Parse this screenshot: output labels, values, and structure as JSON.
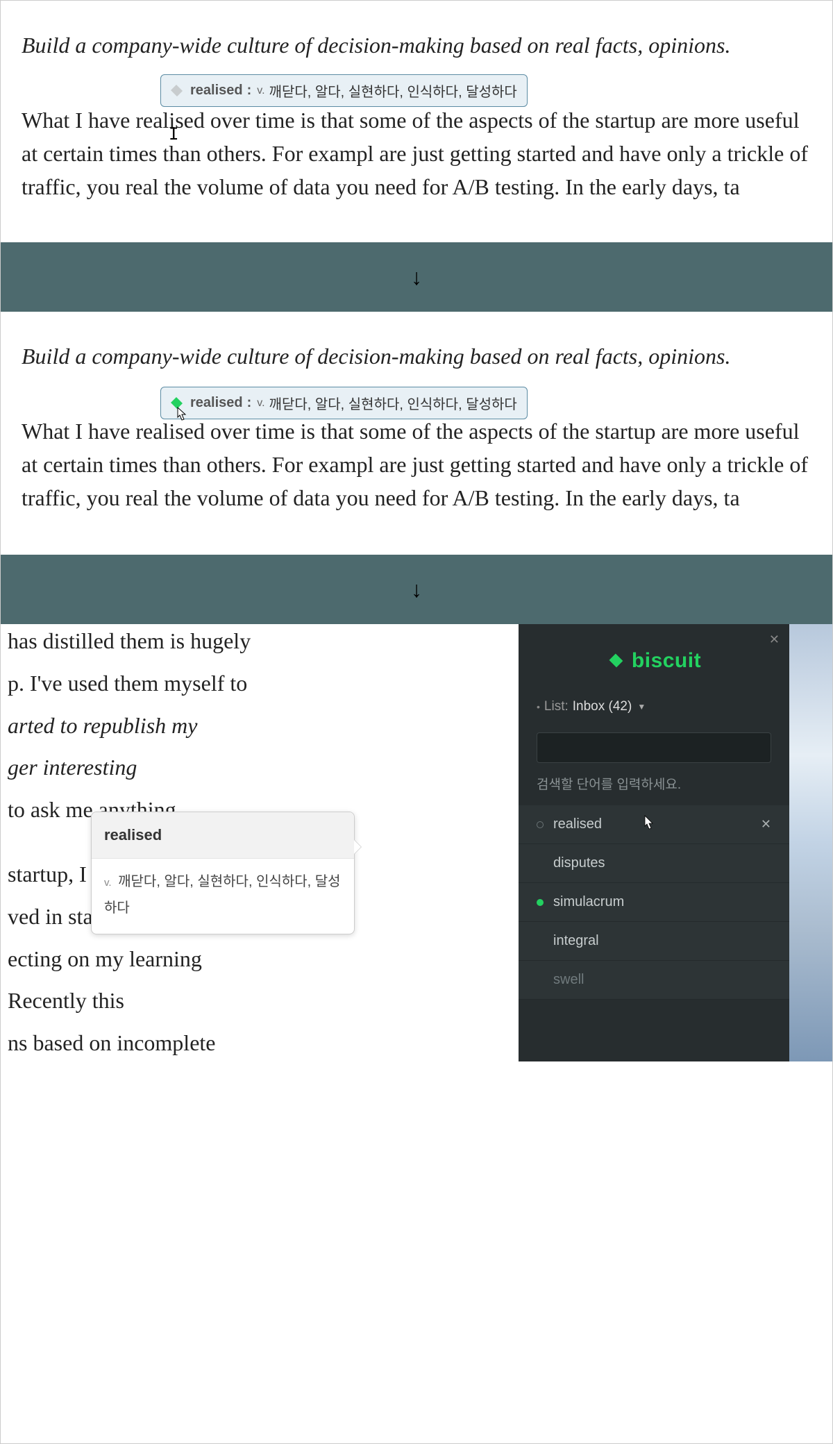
{
  "panel1": {
    "intro": "Build a company-wide culture of decision-making based on real facts, opinions.",
    "body": "What I have realised over time is that some of the aspects of the startup are more useful at certain times than others. For exampl are just getting started and have only a trickle of traffic, you real the volume of data you need for A/B testing. In the early days, ta",
    "tooltip": {
      "word": "realised",
      "pos": "v.",
      "def": "깨닫다, 알다, 실현하다, 인식하다, 달성하다"
    }
  },
  "panel2": {
    "intro": "Build a company-wide culture of decision-making based on real facts, opinions.",
    "body": "What I have realised over time is that some of the aspects of the startup are more useful at certain times than others. For exampl are just getting started and have only a trickle of traffic, you real the volume of data you need for A/B testing. In the early days, ta",
    "tooltip": {
      "word": "realised",
      "pos": "v.",
      "def": "깨닫다, 알다, 실현하다, 인식하다, 달성하다"
    }
  },
  "sep": {
    "arrow": "↓"
  },
  "left": {
    "lines": [
      " has distilled them is hugely",
      "p. I've used them myself to",
      "arted to republish my",
      "ger interesting",
      " to ask me anything.",
      "",
      " startup, I",
      "ved in star",
      "ecting on my learning",
      " Recently this",
      "ns based on incomplete"
    ],
    "popover": {
      "word": "realised",
      "pos": "v.",
      "def": "깨닫다, 알다, 실현하다, 인식하다, 달성하다"
    }
  },
  "sidebar": {
    "brand": "biscuit",
    "list_label": "List:",
    "list_value": "Inbox (42)",
    "search_placeholder": "",
    "search_hint": "검색할 단어를 입력하세요.",
    "items": [
      {
        "word": "realised",
        "dot": "hollow",
        "remove": true
      },
      {
        "word": "disputes",
        "dot": "none",
        "remove": false
      },
      {
        "word": "simulacrum",
        "dot": "green",
        "remove": false
      },
      {
        "word": "integral",
        "dot": "none",
        "remove": false
      },
      {
        "word": "swell",
        "dot": "none",
        "remove": false,
        "muted": true
      }
    ],
    "close": "✕"
  }
}
